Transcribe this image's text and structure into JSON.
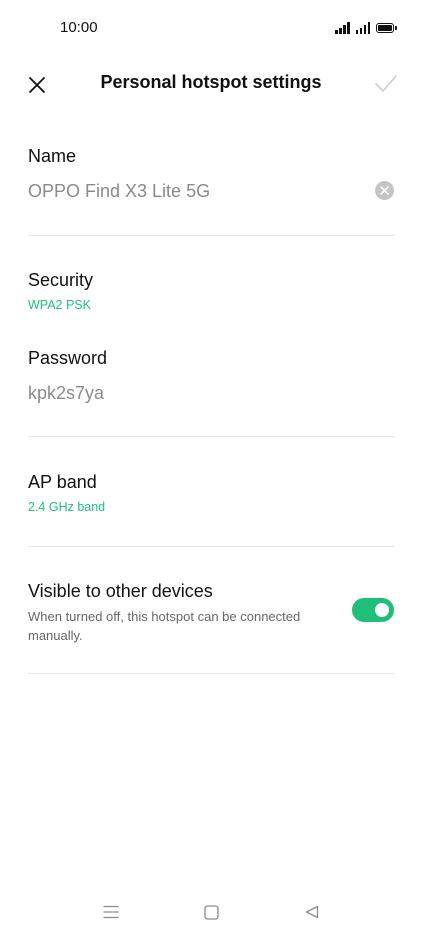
{
  "status_bar": {
    "time": "10:00",
    "icons": [
      "signal-icon",
      "signal-icon",
      "battery-icon"
    ]
  },
  "header": {
    "title": "Personal hotspot settings",
    "close_icon": "close-icon",
    "confirm_icon": "check-icon"
  },
  "name": {
    "label": "Name",
    "value": "OPPO Find X3 Lite 5G",
    "clear_icon": "clear-icon"
  },
  "security": {
    "label": "Security",
    "value": "WPA2 PSK"
  },
  "password": {
    "label": "Password",
    "value": "kpk2s7ya"
  },
  "ap_band": {
    "label": "AP band",
    "value": "2.4 GHz band"
  },
  "visibility": {
    "label": "Visible to other devices",
    "description": "When turned off, this hotspot can be connected manually.",
    "enabled": true
  },
  "nav_bar": {
    "icons": [
      "menu-icon",
      "home-icon",
      "back-icon"
    ]
  },
  "colors": {
    "accent": "#1fbf7a",
    "text_primary": "#111111",
    "text_secondary": "#8a8a8a",
    "divider": "#e6e6e6"
  }
}
